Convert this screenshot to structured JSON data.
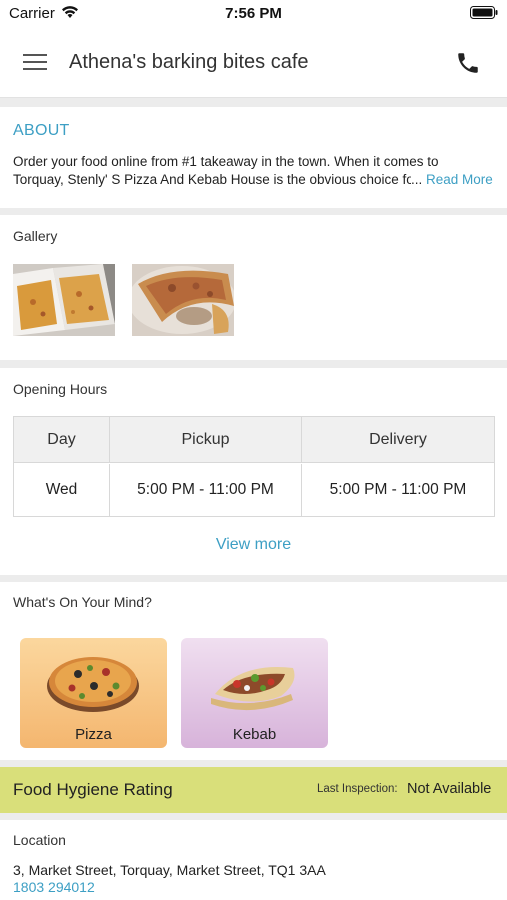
{
  "status_bar": {
    "carrier": "Carrier",
    "time": "7:56 PM"
  },
  "header": {
    "title": "Athena's barking bites cafe",
    "menu_icon": "hamburger-menu-icon",
    "call_icon": "phone-icon"
  },
  "about": {
    "heading": "ABOUT",
    "line1": "Order your food online from #1 takeaway in the town. When it comes to",
    "line2": "Torquay, Stenly' S Pizza And Kebab House is the obvious choice for",
    "ellipsis": "...",
    "read_more": "Read More"
  },
  "gallery": {
    "label": "Gallery",
    "images": [
      "pizza-boxes-photo",
      "pizza-slice-photo"
    ]
  },
  "opening_hours": {
    "label": "Opening Hours",
    "columns": [
      "Day",
      "Pickup",
      "Delivery"
    ],
    "rows": [
      {
        "day": "Wed",
        "pickup": "5:00 PM - 11:00 PM",
        "delivery": "5:00 PM - 11:00 PM"
      }
    ],
    "view_more": "View more"
  },
  "whats_on_your_mind": {
    "label": "What's On Your Mind?",
    "categories": [
      {
        "name": "Pizza"
      },
      {
        "name": "Kebab"
      }
    ]
  },
  "hygiene": {
    "title": "Food Hygiene Rating",
    "last_inspection_label": "Last Inspection:",
    "last_inspection_value": "Not Available"
  },
  "location": {
    "label": "Location",
    "address": "3, Market Street, Torquay, Market Street, TQ1 3AA",
    "phone": "1803 294012"
  },
  "colors": {
    "accent": "#3d9fc4",
    "hygiene_bar": "#d9df7a"
  }
}
